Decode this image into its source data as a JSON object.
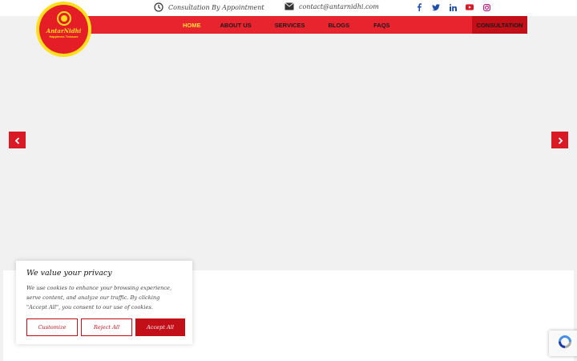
{
  "topbar": {
    "consultation_text": "Consultation By Appointment",
    "email_text": "contact@antarnidhi.com",
    "clock_icon": "clock-icon",
    "mail_icon": "mail-icon",
    "social": [
      "facebook-icon",
      "twitter-icon",
      "linkedin-icon",
      "youtube-icon",
      "instagram-icon"
    ]
  },
  "logo": {
    "name": "AntarNidhi",
    "tagline": "Happiness Treasure"
  },
  "nav": {
    "items": [
      {
        "label": "HOME",
        "active": true
      },
      {
        "label": "ABOUT US",
        "active": false
      },
      {
        "label": "SERVICES",
        "active": false
      },
      {
        "label": "BLOGS",
        "active": false
      },
      {
        "label": "FAQS",
        "active": false
      }
    ],
    "cta_label": "CONSULTATION"
  },
  "slider": {
    "prev_icon": "chevron-left-icon",
    "next_icon": "chevron-right-icon"
  },
  "cookie": {
    "title": "We value your privacy",
    "text": "We use cookies to enhance your browsing experience, serve  content, and analyze our traffic. By clicking \"Accept All\", you consent to our use of cookies.",
    "customize_label": "Customize",
    "reject_label": "Reject All",
    "accept_label": "Accept All"
  },
  "colors": {
    "brand_red": "#e8242f",
    "dark_red": "#c20f18",
    "brand_yellow": "#ffdf1c"
  }
}
